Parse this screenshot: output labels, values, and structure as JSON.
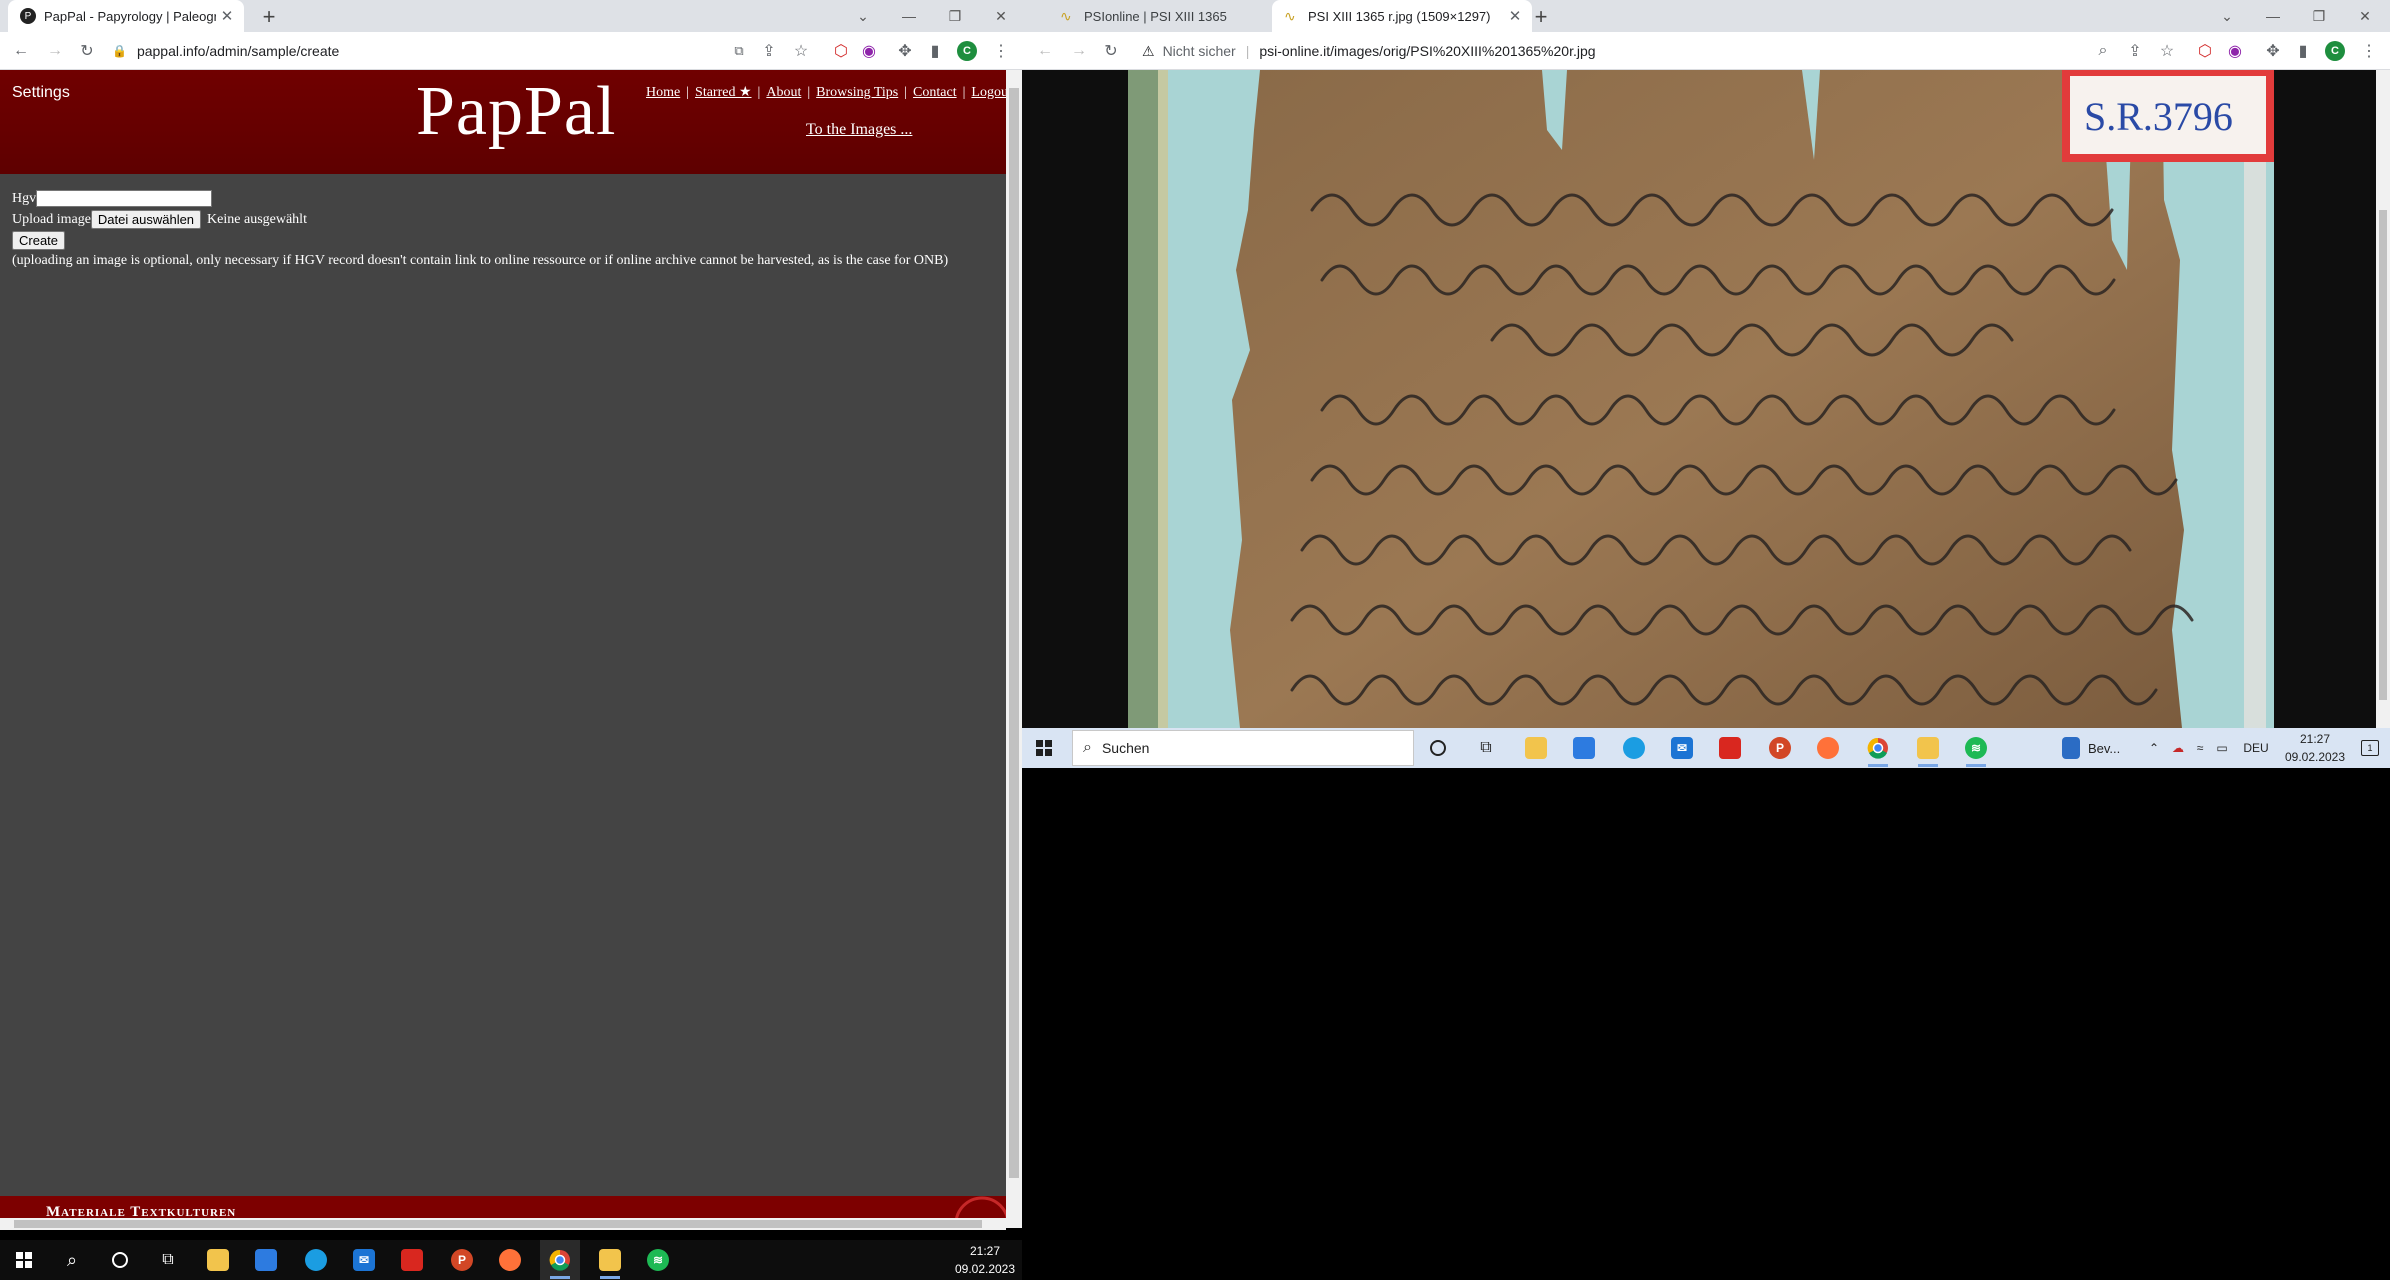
{
  "left_browser": {
    "tab": {
      "title": "PapPal - Papyrology | Paleograph"
    },
    "url": "pappal.info/admin/sample/create",
    "profile_initial": "C"
  },
  "pappal": {
    "settings_label": "Settings",
    "logo": "PapPal",
    "nav": {
      "home": "Home",
      "starred": "Starred ★",
      "about": "About",
      "browsing_tips": "Browsing Tips",
      "contact": "Contact",
      "logout": "Logou"
    },
    "to_images": "To the Images ...",
    "form": {
      "hgv_label": "Hgv",
      "hgv_value": "",
      "upload_label": "Upload image",
      "file_button": "Datei auswählen",
      "file_status": "Keine ausgewählt",
      "create_button": "Create",
      "note": "(uploading an image is optional, only necessary if HGV record doesn't contain link to online ressource or if online archive cannot be harvested, as is the case for ONB)"
    },
    "footer_text": "Materiale Textkulturen"
  },
  "right_browser": {
    "tabs": [
      {
        "title": "PSIonline | PSI XIII 1365"
      },
      {
        "title": "PSI XIII 1365 r.jpg (1509×1297)"
      }
    ],
    "security_label": "Nicht sicher",
    "url": "psi-online.it/images/orig/PSI%20XIII%201365%20r.jpg",
    "profile_initial": "C"
  },
  "image": {
    "label_text": "S.R.3796"
  },
  "taskbar_right": {
    "search_placeholder": "Suchen",
    "open_app_label": "Bev...",
    "language": "DEU",
    "time": "21:27",
    "date": "09.02.2023",
    "notification_count": "1"
  },
  "taskbar_left": {
    "time": "21:27",
    "date": "09.02.2023"
  },
  "colors": {
    "header": "#6b0000",
    "page_bg": "#444444",
    "taskbar_light": "#d9e4f3",
    "taskbar_dark": "#0d0d0d"
  }
}
